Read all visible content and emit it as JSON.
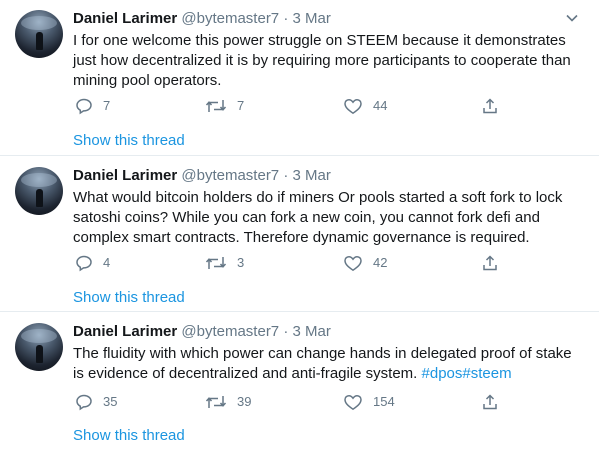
{
  "tweets": [
    {
      "name": "Daniel Larimer",
      "handle": "@bytemaster7",
      "separator": "·",
      "date": "3 Mar",
      "text": "I for one welcome this power struggle on STEEM because it demonstrates just how decentralized it is by requiring more participants to cooperate than mining pool operators.",
      "replies": "7",
      "retweets": "7",
      "likes": "44",
      "thread_label": "Show this thread"
    },
    {
      "name": "Daniel Larimer",
      "handle": "@bytemaster7",
      "separator": "·",
      "date": "3 Mar",
      "text": "What would bitcoin holders do if miners Or pools started a soft fork to lock satoshi coins? While you can fork a new coin, you cannot fork defi and complex smart contracts. Therefore dynamic governance is required.",
      "replies": "4",
      "retweets": "3",
      "likes": "42",
      "thread_label": "Show this thread"
    },
    {
      "name": "Daniel Larimer",
      "handle": "@bytemaster7",
      "separator": "·",
      "date": "3 Mar",
      "text": "The fluidity with which power can change hands in delegated proof of stake is evidence of decentralized and anti-fragile system.",
      "hashtags": [
        "#dpos",
        "#steem"
      ],
      "replies": "35",
      "retweets": "39",
      "likes": "154",
      "thread_label": "Show this thread"
    }
  ],
  "icons": {
    "reply": "reply-icon",
    "retweet": "retweet-icon",
    "like": "like-icon",
    "share": "share-icon",
    "menu": "chevron-down-icon"
  },
  "colors": {
    "link": "#1b95e0",
    "secondary": "#657786",
    "divider": "#e6ecf0",
    "text": "#14171a"
  }
}
